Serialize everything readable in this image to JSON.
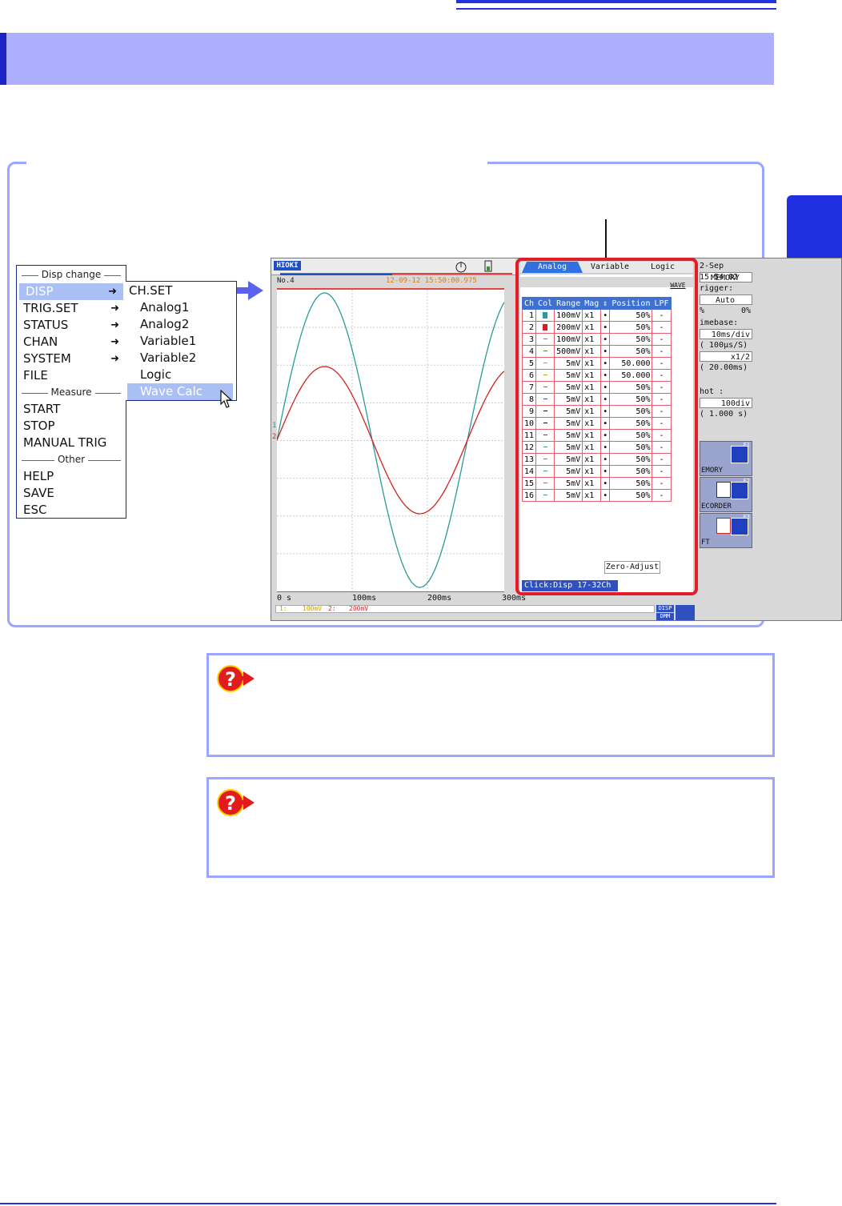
{
  "disp_change_menu": {
    "title": "Disp change",
    "items": [
      {
        "label": "DISP",
        "arrow": "➜"
      },
      {
        "label": "TRIG.SET",
        "arrow": "➜"
      },
      {
        "label": "STATUS",
        "arrow": "➜"
      },
      {
        "label": "CHAN",
        "arrow": "➜"
      },
      {
        "label": "SYSTEM",
        "arrow": "➜"
      },
      {
        "label": "FILE",
        "arrow": ""
      }
    ],
    "measure_header": "Measure",
    "measure_items": [
      "START",
      "STOP",
      "MANUAL TRIG"
    ],
    "other_header": "Other",
    "other_items": [
      "HELP",
      "SAVE",
      "ESC"
    ]
  },
  "disp_submenu": {
    "header": "CH.SET",
    "items": [
      "Analog1",
      "Analog2",
      "Variable1",
      "Variable2",
      "Logic",
      "Wave Calc"
    ]
  },
  "screen": {
    "logo": "HIOKI",
    "record_no": "No.4",
    "timestamp": "12-09-12 15:50:00.975",
    "xaxis_ticks": [
      "0 s",
      "100ms",
      "200ms",
      "300ms"
    ],
    "ch_marker_1": "1",
    "ch_marker_2": "2",
    "bottom_ch1": "1:",
    "bottom_ch1_range": "100mV",
    "bottom_ch2": "2:",
    "bottom_ch2_range": "200mV",
    "bottom_btn_disp": "DISP",
    "bottom_btn_dmm": "DMM",
    "colors": {
      "ch1": "#2a9a9a",
      "ch2": "#d42020",
      "grid": "#c8c8c8"
    }
  },
  "panel": {
    "tabs": [
      "Analog",
      "Variable",
      "Logic"
    ],
    "wave_btn": "WAVE",
    "columns": [
      "Ch",
      "Col",
      "Range",
      "Mag",
      "⇕",
      "Position",
      "LPF"
    ],
    "rows": [
      {
        "ch": "1",
        "range": "100mV",
        "mag": "x1",
        "pos": "50%",
        "lpf": "-"
      },
      {
        "ch": "2",
        "range": "200mV",
        "mag": "x1",
        "pos": "50%",
        "lpf": "-"
      },
      {
        "ch": "3",
        "range": "100mV",
        "mag": "x1",
        "pos": "50%",
        "lpf": "-"
      },
      {
        "ch": "4",
        "range": "500mV",
        "mag": "x1",
        "pos": "50%",
        "lpf": "-"
      },
      {
        "ch": "5",
        "range": "5mV",
        "mag": "x1",
        "pos": "50.000",
        "lpf": "-"
      },
      {
        "ch": "6",
        "range": "5mV",
        "mag": "x1",
        "pos": "50.000",
        "lpf": "-"
      },
      {
        "ch": "7",
        "range": "5mV",
        "mag": "x1",
        "pos": "50%",
        "lpf": "-"
      },
      {
        "ch": "8",
        "range": "5mV",
        "mag": "x1",
        "pos": "50%",
        "lpf": "-"
      },
      {
        "ch": "9",
        "range": "5mV",
        "mag": "x1",
        "pos": "50%",
        "lpf": "-"
      },
      {
        "ch": "10",
        "range": "5mV",
        "mag": "x1",
        "pos": "50%",
        "lpf": "-"
      },
      {
        "ch": "11",
        "range": "5mV",
        "mag": "x1",
        "pos": "50%",
        "lpf": "-"
      },
      {
        "ch": "12",
        "range": "5mV",
        "mag": "x1",
        "pos": "50%",
        "lpf": "-"
      },
      {
        "ch": "13",
        "range": "5mV",
        "mag": "x1",
        "pos": "50%",
        "lpf": "-"
      },
      {
        "ch": "14",
        "range": "5mV",
        "mag": "x1",
        "pos": "50%",
        "lpf": "-"
      },
      {
        "ch": "15",
        "range": "5mV",
        "mag": "x1",
        "pos": "50%",
        "lpf": "-"
      },
      {
        "ch": "16",
        "range": "5mV",
        "mag": "x1",
        "pos": "50%",
        "lpf": "-"
      }
    ],
    "row_dot": "•",
    "zero_adjust": "Zero-Adjust",
    "click_disp": "Click:Disp 17-32Ch"
  },
  "right_status": {
    "datetime": "2-Sep 15:54:02",
    "mode": "MEMORY",
    "trigger_label": "rigger:",
    "trigger_value": "Auto",
    "pct_label": "%",
    "pct_value": "0%",
    "timebase_label": "imebase:",
    "timebase_value": "10ms/div",
    "sampling": "( 100μs/S)",
    "zoom": "x1/2",
    "window": "( 20.00ms)",
    "shot_label": "hot    :",
    "shot_value": "100div",
    "shot_time": "( 1.000 s)",
    "func_memory": "EMORY",
    "func_recorder": "ECORDER",
    "func_fft": "FT",
    "f1": "F1",
    "f2": "F2",
    "f3": "F3"
  },
  "help_icon": "?"
}
